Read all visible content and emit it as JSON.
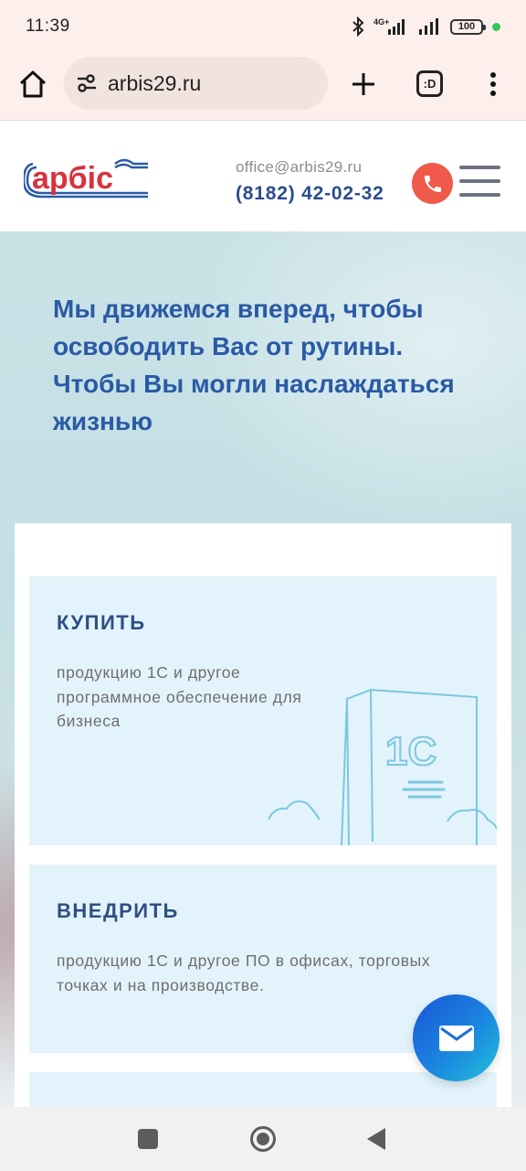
{
  "status_bar": {
    "time": "11:39",
    "network": "4G+",
    "battery": "100"
  },
  "browser": {
    "url": "arbis29.ru",
    "tabs_label": ":D"
  },
  "header": {
    "logo_text": "арбіс",
    "email": "office@arbis29.ru",
    "phone": "(8182) 42-02-32"
  },
  "hero": {
    "title": "Мы движемся вперед, чтобы освободить Вас от рутины. Чтобы Вы могли наслаждаться жизнью"
  },
  "services": [
    {
      "heading": "КУПИТЬ",
      "text": "продукцию 1С и другое программное обеспечение для бизнеса"
    },
    {
      "heading": "ВНЕДРИТЬ",
      "text": "продукцию 1С и другое ПО в офисах, торговых точках и на производстве."
    }
  ],
  "illustration": {
    "box_logo": "1С"
  },
  "colors": {
    "brand_blue": "#2a5aa5",
    "phone_red": "#ef5a4a",
    "card_bg": "#e3f3fb"
  }
}
